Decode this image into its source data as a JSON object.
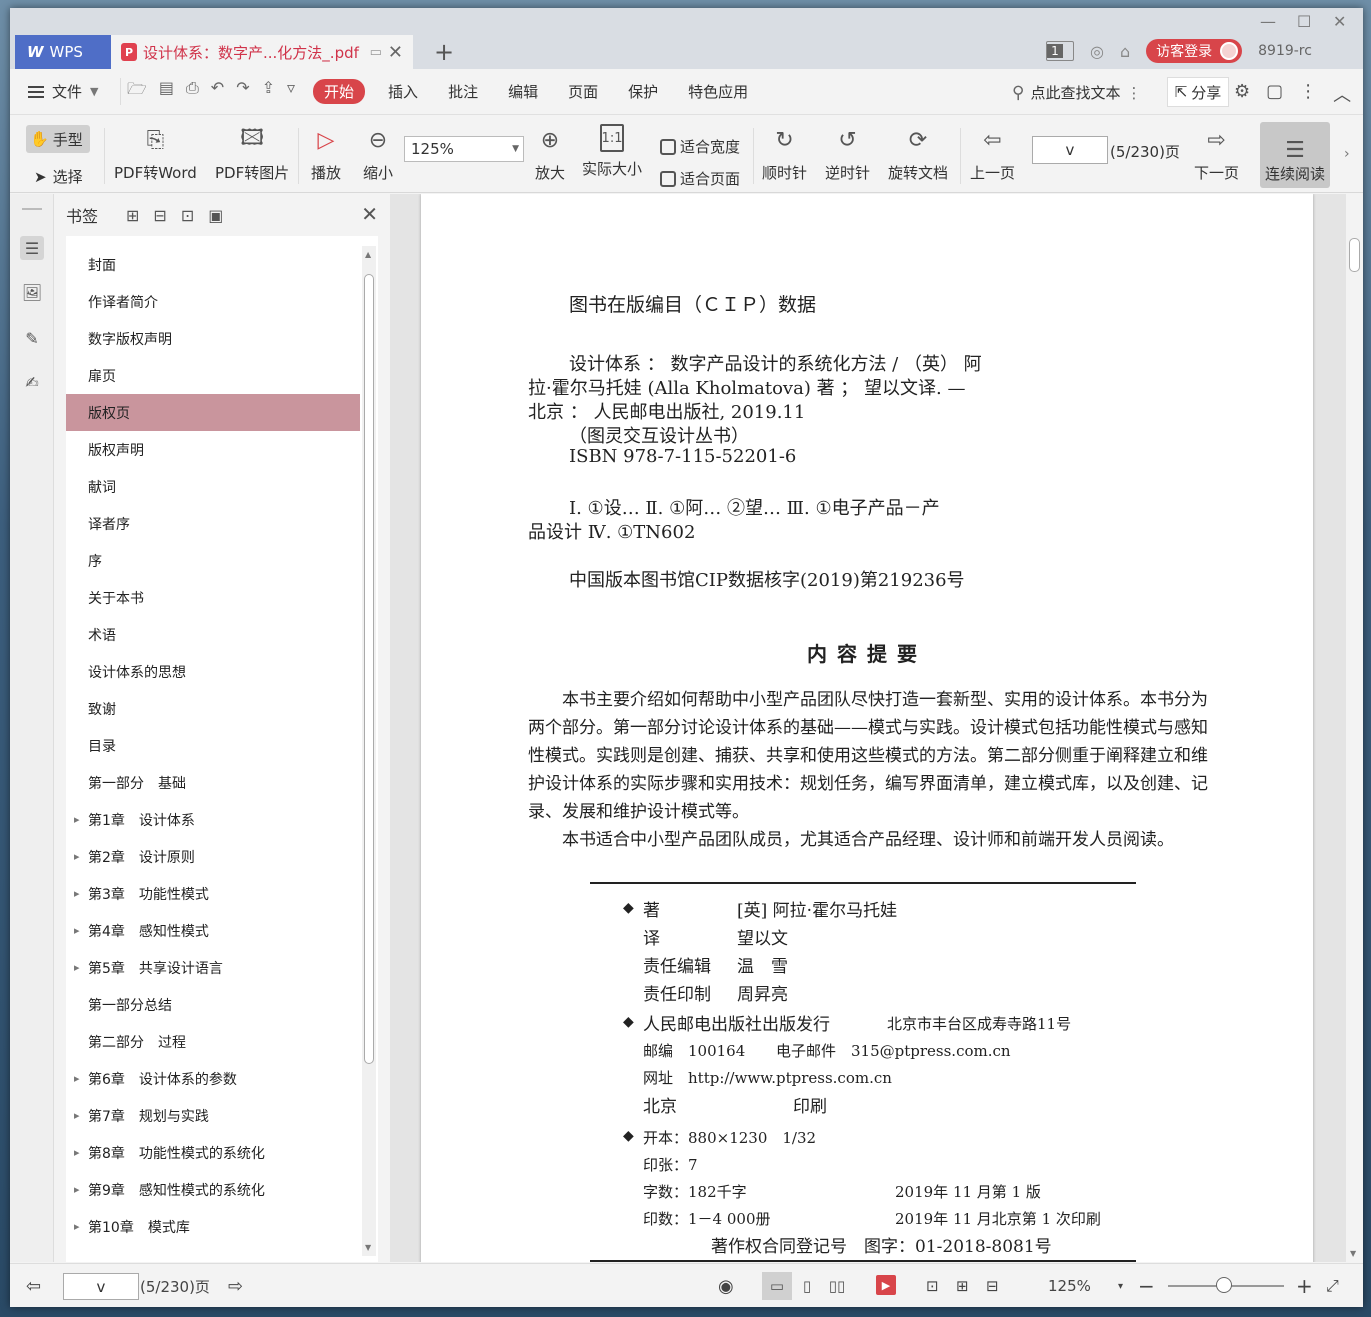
{
  "tabbar": {
    "app_name": "WPS",
    "doc_tab_title": "设计体系：数字产...化方法_.pdf",
    "page_count_badge": "1",
    "login_label": "访客登录",
    "user_id": "8919-rc"
  },
  "menubar": {
    "file_label": "文件",
    "items": [
      "开始",
      "插入",
      "批注",
      "编辑",
      "页面",
      "保护",
      "特色应用"
    ],
    "search_label": "点此查找文本",
    "share_label": "分享"
  },
  "toolbar": {
    "hand_label": "手型",
    "select_label": "选择",
    "pdf_to_word": "PDF转Word",
    "pdf_to_image": "PDF转图片",
    "play": "播放",
    "zoom_out": "缩小",
    "zoom_value": "125%",
    "zoom_in": "放大",
    "actual_size": "实际大小",
    "fit_width": "适合宽度",
    "fit_page": "适合页面",
    "rotate_cw": "顺时针",
    "rotate_ccw": "逆时针",
    "rotate_doc": "旋转文档",
    "prev_page": "上一页",
    "page_input": "v",
    "page_total": "(5/230)页",
    "next_page": "下一页",
    "continuous": "连续阅读"
  },
  "bookmarks": {
    "title": "书签",
    "items": [
      {
        "label": "封面",
        "expandable": false,
        "selected": false
      },
      {
        "label": "作译者简介",
        "expandable": false,
        "selected": false
      },
      {
        "label": "数字版权声明",
        "expandable": false,
        "selected": false
      },
      {
        "label": "扉页",
        "expandable": false,
        "selected": false
      },
      {
        "label": "版权页",
        "expandable": false,
        "selected": true
      },
      {
        "label": "版权声明",
        "expandable": false,
        "selected": false
      },
      {
        "label": "献词",
        "expandable": false,
        "selected": false
      },
      {
        "label": "译者序",
        "expandable": false,
        "selected": false
      },
      {
        "label": "序",
        "expandable": false,
        "selected": false
      },
      {
        "label": "关于本书",
        "expandable": false,
        "selected": false
      },
      {
        "label": "术语",
        "expandable": false,
        "selected": false
      },
      {
        "label": "设计体系的思想",
        "expandable": false,
        "selected": false
      },
      {
        "label": "致谢",
        "expandable": false,
        "selected": false
      },
      {
        "label": "目录",
        "expandable": false,
        "selected": false
      },
      {
        "label": "第一部分　基础",
        "expandable": false,
        "selected": false
      },
      {
        "label": "第1章　设计体系",
        "expandable": true,
        "selected": false
      },
      {
        "label": "第2章　设计原则",
        "expandable": true,
        "selected": false
      },
      {
        "label": "第3章　功能性模式",
        "expandable": true,
        "selected": false
      },
      {
        "label": "第4章　感知性模式",
        "expandable": true,
        "selected": false
      },
      {
        "label": "第5章　共享设计语言",
        "expandable": true,
        "selected": false
      },
      {
        "label": "第一部分总结",
        "expandable": false,
        "selected": false
      },
      {
        "label": "第二部分　过程",
        "expandable": false,
        "selected": false
      },
      {
        "label": "第6章　设计体系的参数",
        "expandable": true,
        "selected": false
      },
      {
        "label": "第7章　规划与实践",
        "expandable": true,
        "selected": false
      },
      {
        "label": "第8章　功能性模式的系统化",
        "expandable": true,
        "selected": false
      },
      {
        "label": "第9章　感知性模式的系统化",
        "expandable": true,
        "selected": false
      },
      {
        "label": "第10章　模式库",
        "expandable": true,
        "selected": false
      }
    ]
  },
  "document": {
    "cip_title": "图书在版编目（ＣＩＰ）数据",
    "cip_lines": [
      "设计体系 ： 数字产品设计的系统化方法 / （英） 阿",
      "拉·霍尔马托娃 (Alla Kholmatova) 著 ； 望以文译. —",
      "北京 ： 人民邮电出版社, 2019.11",
      "（图灵交互设计丛书）",
      "ISBN 978-7-115-52201-6",
      "Ⅰ. ①设… Ⅱ. ①阿… ②望… Ⅲ. ①电子产品－产",
      "品设计 Ⅳ. ①TN602",
      "中国版本图书馆CIP数据核字(2019)第219236号"
    ],
    "summary_title": "内容提要",
    "summary_paragraphs": [
      "本书主要介绍如何帮助中小型产品团队尽快打造一套新型、实用的设计体系。本书分为两个部分。第一部分讨论设计体系的基础——模式与实践。设计模式包括功能性模式与感知性模式。实践则是创建、捕获、共享和使用这些模式的方法。第二部分侧重于阐释建立和维护设计体系的实际步骤和实用技术：规划任务，编写界面清单，建立模式库，以及创建、记录、发展和维护设计模式等。",
      "本书适合中小型产品团队成员，尤其适合产品经理、设计师和前端开发人员阅读。"
    ],
    "credits": {
      "author_label": "著",
      "author": "[英] 阿拉·霍尔马托娃",
      "translator_label": "译",
      "translator": "望以文",
      "editor_label": "责任编辑",
      "editor": "温　雪",
      "printer_label": "责任印制",
      "printer": "周昇亮",
      "publisher": "人民邮电出版社出版发行",
      "address": "北京市丰台区成寿寺路11号",
      "postcode": "邮编　100164",
      "email": "电子邮件　315@ptpress.com.cn",
      "website": "网址　http://www.ptpress.com.cn",
      "print_city": "北京",
      "print_label": "印刷",
      "format": "开本：880×1230　1/32",
      "sheets": "印张：7",
      "words": "字数：182千字",
      "edition": "2019年 11 月第 1 版",
      "copies": "印数：1－4 000册",
      "printing": "2019年 11 月北京第 1 次印刷",
      "copyright_reg": "著作权合同登记号　图字：01-2018-8081号"
    }
  },
  "statusbar": {
    "page_input": "v",
    "page_total": "(5/230)页",
    "zoom_value": "125%"
  },
  "colors": {
    "accent": "#d8454a",
    "wps_blue": "#4f6ec7",
    "selected_bookmark": "#c9959d"
  }
}
